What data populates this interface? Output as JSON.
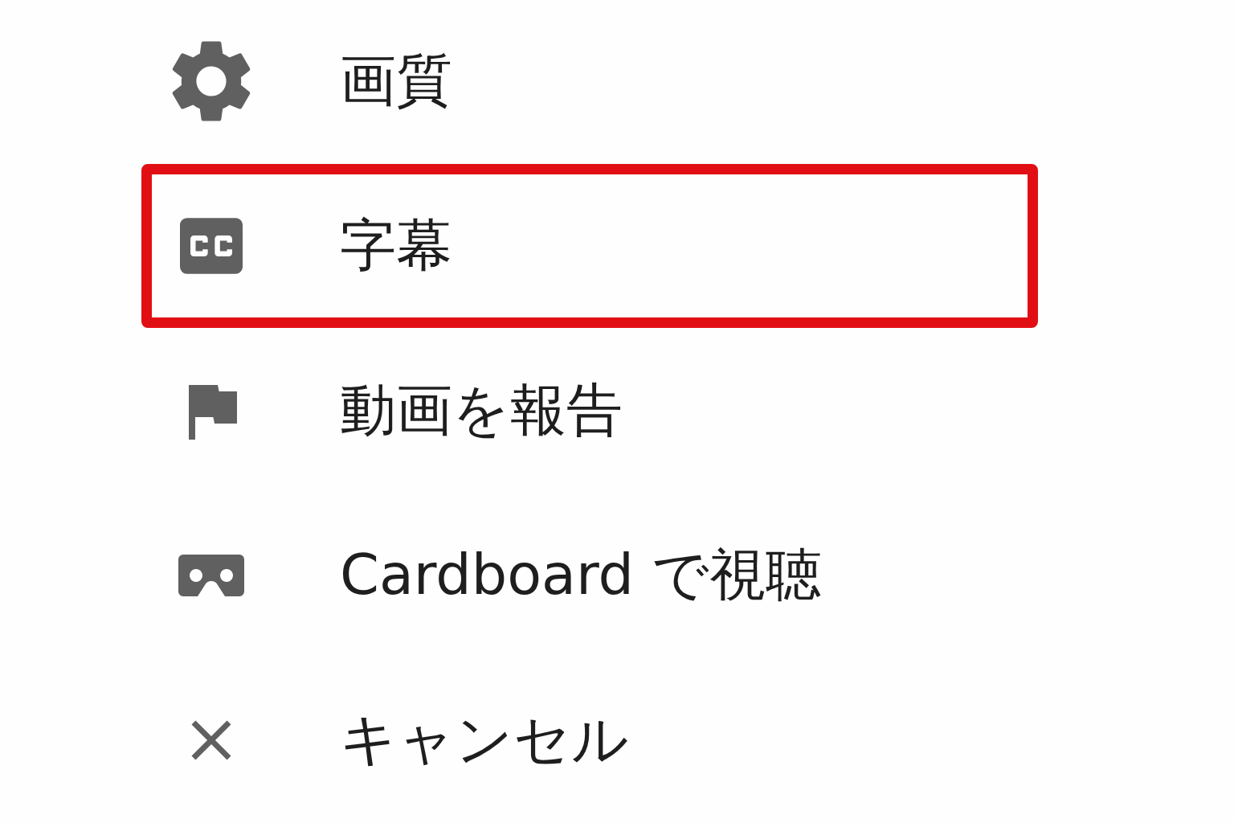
{
  "menu": {
    "items": [
      {
        "kind": "gear",
        "label": "画質",
        "highlighted": false
      },
      {
        "kind": "captions",
        "label": "字幕",
        "highlighted": true
      },
      {
        "kind": "flag",
        "label": "動画を報告",
        "highlighted": false
      },
      {
        "kind": "cardboard",
        "label": "Cardboard で視聴",
        "highlighted": false
      },
      {
        "kind": "close",
        "label": "キャンセル",
        "highlighted": false
      }
    ]
  }
}
